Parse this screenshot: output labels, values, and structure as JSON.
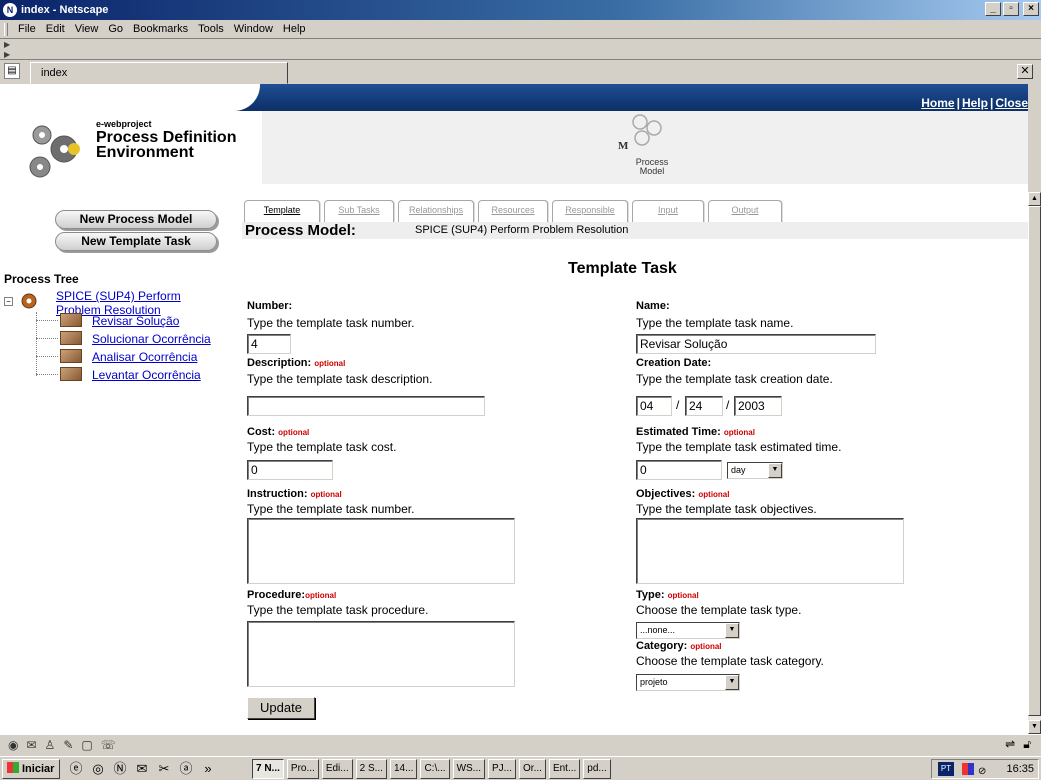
{
  "window": {
    "title": "index - Netscape",
    "controls": [
      "_",
      "▫",
      "×"
    ]
  },
  "menu": [
    "File",
    "Edit",
    "View",
    "Go",
    "Bookmarks",
    "Tools",
    "Window",
    "Help"
  ],
  "tab": {
    "label": "index"
  },
  "header": {
    "top_links": [
      "Home",
      "Help",
      "Close"
    ],
    "logo_sub": "e-webproject",
    "logo_title_line1": "Process Definition",
    "logo_title_line2": "Environment",
    "pm_logo_text": "Process Model",
    "pm_logo_letter": "M"
  },
  "sidebar": {
    "buttons": [
      "New Process Model",
      "New Template Task"
    ],
    "tree_title": "Process Tree",
    "tree_root_line1": "SPICE (SUP4) Perform",
    "tree_root_line2": "Problem Resolution",
    "tree_children": [
      "Revisar Solução",
      "Solucionar Ocorrência",
      "Analisar Ocorrência",
      "Levantar Ocorrência"
    ]
  },
  "tabs": [
    "Template",
    "Sub Tasks",
    "Relationships",
    "Resources",
    "Responsible",
    "Input",
    "Output"
  ],
  "active_tab": "Template",
  "process_model": {
    "label": "Process Model:",
    "value": "SPICE (SUP4) Perform Problem Resolution"
  },
  "form": {
    "title": "Template Task",
    "optional": "optional",
    "number": {
      "label": "Number:",
      "help": "Type the template task number.",
      "value": "4"
    },
    "name": {
      "label": "Name:",
      "help": "Type the template task name.",
      "value": "Revisar Solução"
    },
    "description": {
      "label": "Description:",
      "help": "Type the template task description.",
      "value": ""
    },
    "creation_date": {
      "label": "Creation Date:",
      "help": "Type the template task creation date.",
      "month": "04",
      "day": "24",
      "year": "2003",
      "sep": "/"
    },
    "cost": {
      "label": "Cost:",
      "help": "Type the template task cost.",
      "value": "0"
    },
    "estimated_time": {
      "label": "Estimated Time:",
      "help": "Type the template task estimated time.",
      "value": "0",
      "unit": "day"
    },
    "instruction": {
      "label": "Instruction:",
      "help": "Type the template task number."
    },
    "objectives": {
      "label": "Objectives:",
      "help": "Type the template task objectives."
    },
    "procedure": {
      "label": "Procedure:",
      "help": "Type the template task procedure."
    },
    "type": {
      "label": "Type:",
      "help": "Choose the template task type.",
      "value": "...none..."
    },
    "category": {
      "label": "Category:",
      "help": "Choose the template task category.",
      "value": "projeto"
    },
    "update_label": "Update"
  },
  "taskbar": {
    "start_label": "Iniciar",
    "more": "»",
    "buttons": [
      "7 N...",
      "Pro...",
      "Edi...",
      "2 S...",
      "14...",
      "C:\\...",
      "WS...",
      "PJ...",
      "Or...",
      "Ent...",
      "pd..."
    ],
    "lang": "PT",
    "clock": "16:35"
  }
}
